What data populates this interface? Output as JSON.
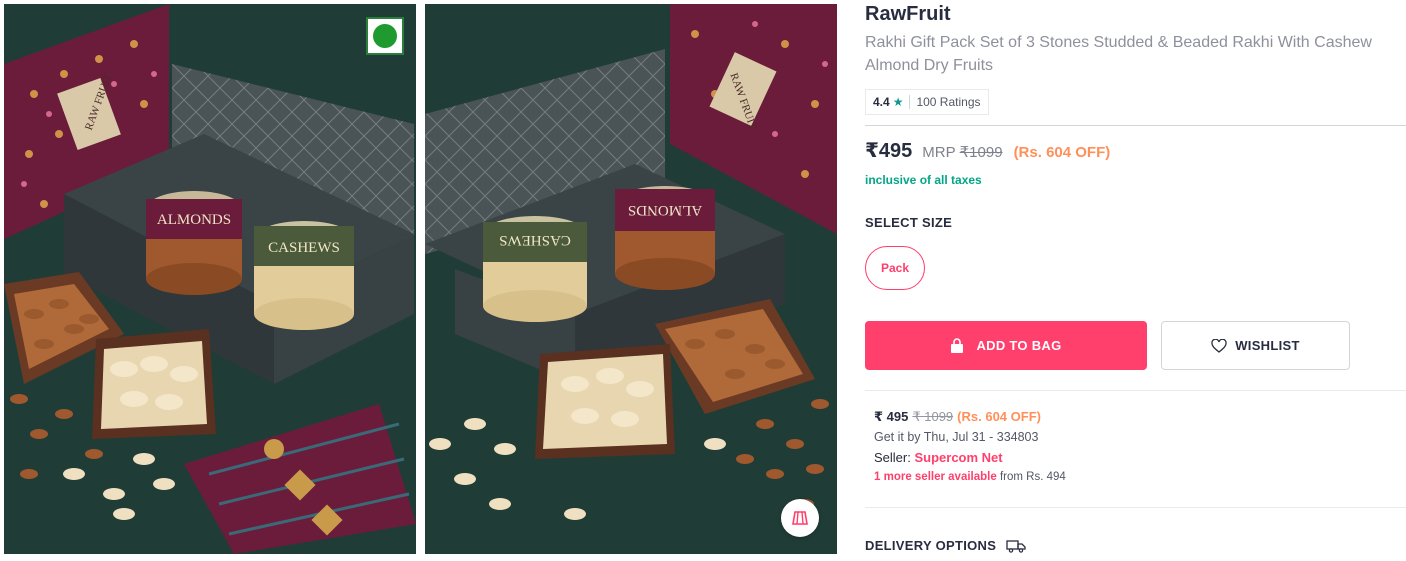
{
  "product": {
    "brand": "RawFruit",
    "title": "Rakhi Gift Pack Set of 3 Stones Studded & Beaded Rakhi With Cashew Almond Dry Fruits",
    "rating": {
      "value": "4.4",
      "star": "★",
      "count": "100 Ratings"
    },
    "price": "₹495",
    "mrp_label": "MRP",
    "mrp": "₹1099",
    "discount": "(Rs. 604 OFF)",
    "tax_note": "inclusive of all taxes",
    "size_title": "SELECT SIZE",
    "sizes": [
      "Pack"
    ],
    "add_to_bag": "ADD TO BAG",
    "wishlist": "WISHLIST"
  },
  "seller_info": {
    "price": "₹ 495",
    "mrp": "₹ 1099",
    "discount": "(Rs. 604 OFF)",
    "delivery": "Get it by Thu, Jul 31 - 334803",
    "seller_label": "Seller:",
    "seller_name": "Supercom Net",
    "more_sellers": "1 more seller available",
    "more_sellers_from": "from Rs. 494"
  },
  "delivery": {
    "title": "DELIVERY OPTIONS"
  },
  "images": {
    "left": {
      "jar1_label": "ALMONDS",
      "jar2_label": "CASHEWS",
      "brand_label": "RAW FRUIT"
    },
    "right": {
      "jar1_label": "ALMONDS",
      "jar2_label": "CASHEWS",
      "brand_label": "RAW FRUIT"
    }
  },
  "icons": {
    "veg": "veg-indicator-icon",
    "similar": "view-similar-icon",
    "bag": "bag-icon",
    "heart": "heart-icon",
    "truck": "truck-icon"
  },
  "colors": {
    "accent": "#ff3f6c",
    "discount": "#ff905a",
    "tax": "#03a685",
    "rating_star": "#14958f",
    "image_bg": "#1e3a34"
  }
}
